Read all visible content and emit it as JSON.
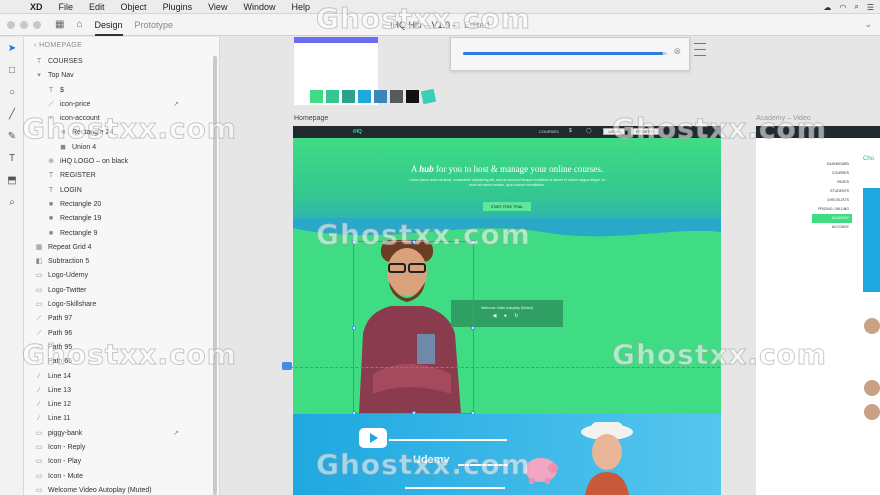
{
  "menubar": {
    "app": "XD",
    "items": [
      "File",
      "Edit",
      "Object",
      "Plugins",
      "View",
      "Window",
      "Help"
    ]
  },
  "titlebar": {
    "tabs": [
      "Design",
      "Prototype"
    ],
    "doc_title": "iHQ Hifi – V1.0",
    "status": "Edited",
    "zoom": "⌄"
  },
  "layers": {
    "breadcrumb": "HOMEPAGE",
    "items": [
      {
        "label": "COURSES",
        "indent": 0,
        "icon": "T"
      },
      {
        "label": "Top Nav",
        "indent": 0,
        "icon": "▾"
      },
      {
        "label": "$",
        "indent": 1,
        "icon": "T"
      },
      {
        "label": "icon-price",
        "indent": 1,
        "icon": "⟋",
        "linked": true
      },
      {
        "label": "icon-account",
        "indent": 1,
        "icon": "▾"
      },
      {
        "label": "Rectangle 24",
        "indent": 2,
        "icon": "■"
      },
      {
        "label": "Union 4",
        "indent": 2,
        "icon": "◼"
      },
      {
        "label": "iHQ LOGO – on black",
        "indent": 1,
        "icon": "⊕"
      },
      {
        "label": "REGISTER",
        "indent": 1,
        "icon": "T"
      },
      {
        "label": "LOGIN",
        "indent": 1,
        "icon": "T"
      },
      {
        "label": "Rectangle 20",
        "indent": 1,
        "icon": "■"
      },
      {
        "label": "Rectangle 19",
        "indent": 1,
        "icon": "■"
      },
      {
        "label": "Rectangle 9",
        "indent": 1,
        "icon": "■"
      },
      {
        "label": "Repeat Grid 4",
        "indent": 0,
        "icon": "▦"
      },
      {
        "label": "Subtraction 5",
        "indent": 0,
        "icon": "◧"
      },
      {
        "label": "Logo-Udemy",
        "indent": 0,
        "icon": "▭"
      },
      {
        "label": "Logo-Twitter",
        "indent": 0,
        "icon": "▭"
      },
      {
        "label": "Logo-Skillshare",
        "indent": 0,
        "icon": "▭"
      },
      {
        "label": "Path 97",
        "indent": 0,
        "icon": "⟋"
      },
      {
        "label": "Path 96",
        "indent": 0,
        "icon": "⟋"
      },
      {
        "label": "Path 95",
        "indent": 0,
        "icon": "⟋"
      },
      {
        "label": "Path 66",
        "indent": 0,
        "icon": "⟋"
      },
      {
        "label": "Line 14",
        "indent": 0,
        "icon": "⁄"
      },
      {
        "label": "Line 13",
        "indent": 0,
        "icon": "⁄"
      },
      {
        "label": "Line 12",
        "indent": 0,
        "icon": "⁄"
      },
      {
        "label": "Line 11",
        "indent": 0,
        "icon": "⁄"
      },
      {
        "label": "piggy-bank",
        "indent": 0,
        "icon": "▭",
        "linked": true
      },
      {
        "label": "Icon - Reply",
        "indent": 0,
        "icon": "▭"
      },
      {
        "label": "Icon - Play",
        "indent": 0,
        "icon": "▭"
      },
      {
        "label": "Icon - Mute",
        "indent": 0,
        "icon": "▭"
      },
      {
        "label": "Welcome Video Autoplay (Muted)",
        "indent": 0,
        "icon": "▭"
      }
    ]
  },
  "canvas": {
    "homepage_label": "Homepage",
    "right_label": "Academy – Video",
    "swatches": [
      "#3fdc84",
      "#33c78f",
      "#2aa38a",
      "#1fa8e0",
      "#3a86b4",
      "#555a5c",
      "#111111",
      "#3ad0b8"
    ],
    "upload_progress": 0.98
  },
  "artboard": {
    "logo": "iHQ",
    "nav_courses": "COURSES",
    "nav_login": "LOGIN",
    "nav_register": "REGISTER",
    "hero_title_pre": "A",
    "hero_title_em": "hub",
    "hero_title_post": "for you to host & manage your online courses.",
    "hero_text": "Lorem ipsum dolor sit amet, consectetur adipisicing elit, sed do eiusmod tempor incididunt ut labore et dolore magna aliqua. Ut enim ad minim veniam, quis nostrud exercitation.",
    "hero_button": "START FREE TRIAL",
    "video_title": "Welcome Video Autoplay (Muted)",
    "video_controls": "◀ ● ↻",
    "udemy": "Udemy"
  },
  "right_artboard": {
    "menu": [
      "DASHBOARD",
      "COURSES",
      "PAGES",
      "STUDENTS",
      "CHECKLISTS",
      "PRICING / BILLING",
      "ACADEMY",
      "ACCOUNT"
    ],
    "active": "ACADEMY",
    "heading": "Cho"
  },
  "watermark": "Ghostxx.com"
}
